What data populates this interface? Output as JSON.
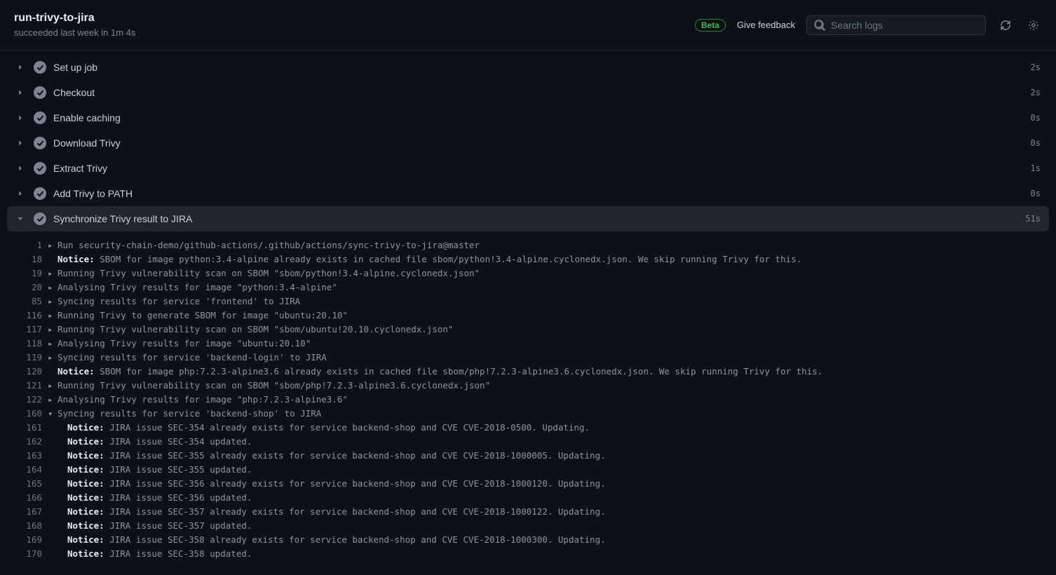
{
  "header": {
    "title": "run-trivy-to-jira",
    "subtitle": "succeeded last week in 1m 4s",
    "beta_label": "Beta",
    "feedback_label": "Give feedback",
    "search_placeholder": "Search logs"
  },
  "steps": [
    {
      "title": "Set up job",
      "duration": "2s",
      "expanded": false
    },
    {
      "title": "Checkout",
      "duration": "2s",
      "expanded": false
    },
    {
      "title": "Enable caching",
      "duration": "0s",
      "expanded": false
    },
    {
      "title": "Download Trivy",
      "duration": "0s",
      "expanded": false
    },
    {
      "title": "Extract Trivy",
      "duration": "1s",
      "expanded": false
    },
    {
      "title": "Add Trivy to PATH",
      "duration": "0s",
      "expanded": false
    },
    {
      "title": "Synchronize Trivy result to JIRA",
      "duration": "51s",
      "expanded": true
    }
  ],
  "log_lines": [
    {
      "n": "1",
      "toggle": "right",
      "notice": false,
      "indent": false,
      "text": "Run security-chain-demo/github-actions/.github/actions/sync-trivy-to-jira@master"
    },
    {
      "n": "18",
      "toggle": "",
      "notice": true,
      "indent": false,
      "text": "SBOM for image python:3.4-alpine already exists in cached file sbom/python!3.4-alpine.cyclonedx.json. We skip running Trivy for this."
    },
    {
      "n": "19",
      "toggle": "right",
      "notice": false,
      "indent": false,
      "text": "Running Trivy vulnerability scan on SBOM \"sbom/python!3.4-alpine.cyclonedx.json\""
    },
    {
      "n": "20",
      "toggle": "right",
      "notice": false,
      "indent": false,
      "text": "Analysing Trivy results for image \"python:3.4-alpine\""
    },
    {
      "n": "85",
      "toggle": "right",
      "notice": false,
      "indent": false,
      "text": "Syncing results for service 'frontend' to JIRA"
    },
    {
      "n": "116",
      "toggle": "right",
      "notice": false,
      "indent": false,
      "text": "Running Trivy to generate SBOM for image \"ubuntu:20.10\""
    },
    {
      "n": "117",
      "toggle": "right",
      "notice": false,
      "indent": false,
      "text": "Running Trivy vulnerability scan on SBOM \"sbom/ubuntu!20.10.cyclonedx.json\""
    },
    {
      "n": "118",
      "toggle": "right",
      "notice": false,
      "indent": false,
      "text": "Analysing Trivy results for image \"ubuntu:20.10\""
    },
    {
      "n": "119",
      "toggle": "right",
      "notice": false,
      "indent": false,
      "text": "Syncing results for service 'backend-login' to JIRA"
    },
    {
      "n": "120",
      "toggle": "",
      "notice": true,
      "indent": false,
      "text": "SBOM for image php:7.2.3-alpine3.6 already exists in cached file sbom/php!7.2.3-alpine3.6.cyclonedx.json. We skip running Trivy for this."
    },
    {
      "n": "121",
      "toggle": "right",
      "notice": false,
      "indent": false,
      "text": "Running Trivy vulnerability scan on SBOM \"sbom/php!7.2.3-alpine3.6.cyclonedx.json\""
    },
    {
      "n": "122",
      "toggle": "right",
      "notice": false,
      "indent": false,
      "text": "Analysing Trivy results for image \"php:7.2.3-alpine3.6\""
    },
    {
      "n": "160",
      "toggle": "down",
      "notice": false,
      "indent": false,
      "text": "Syncing results for service 'backend-shop' to JIRA"
    },
    {
      "n": "161",
      "toggle": "",
      "notice": true,
      "indent": true,
      "text": "JIRA issue SEC-354 already exists for service backend-shop and CVE CVE-2018-0500. Updating."
    },
    {
      "n": "162",
      "toggle": "",
      "notice": true,
      "indent": true,
      "text": "JIRA issue SEC-354 updated."
    },
    {
      "n": "163",
      "toggle": "",
      "notice": true,
      "indent": true,
      "text": "JIRA issue SEC-355 already exists for service backend-shop and CVE CVE-2018-1000005. Updating."
    },
    {
      "n": "164",
      "toggle": "",
      "notice": true,
      "indent": true,
      "text": "JIRA issue SEC-355 updated."
    },
    {
      "n": "165",
      "toggle": "",
      "notice": true,
      "indent": true,
      "text": "JIRA issue SEC-356 already exists for service backend-shop and CVE CVE-2018-1000120. Updating."
    },
    {
      "n": "166",
      "toggle": "",
      "notice": true,
      "indent": true,
      "text": "JIRA issue SEC-356 updated."
    },
    {
      "n": "167",
      "toggle": "",
      "notice": true,
      "indent": true,
      "text": "JIRA issue SEC-357 already exists for service backend-shop and CVE CVE-2018-1000122. Updating."
    },
    {
      "n": "168",
      "toggle": "",
      "notice": true,
      "indent": true,
      "text": "JIRA issue SEC-357 updated."
    },
    {
      "n": "169",
      "toggle": "",
      "notice": true,
      "indent": true,
      "text": "JIRA issue SEC-358 already exists for service backend-shop and CVE CVE-2018-1000300. Updating."
    },
    {
      "n": "170",
      "toggle": "",
      "notice": true,
      "indent": true,
      "text": "JIRA issue SEC-358 updated."
    }
  ]
}
